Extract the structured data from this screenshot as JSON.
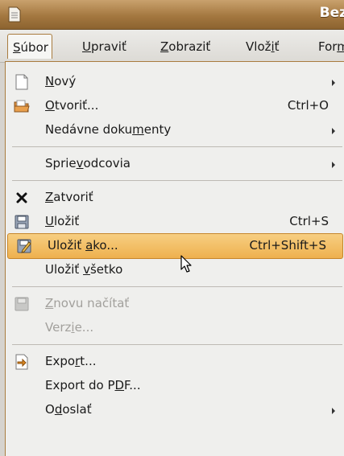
{
  "window": {
    "title": "Bez"
  },
  "menubar": {
    "items": [
      {
        "label": "Súbor",
        "mnemonic": 0,
        "active": true
      },
      {
        "label": "Upraviť",
        "mnemonic": 0
      },
      {
        "label": "Zobraziť",
        "mnemonic": 0
      },
      {
        "label": "Vložiť",
        "mnemonic": 4
      },
      {
        "label": "Form",
        "mnemonic": 3
      }
    ]
  },
  "file_menu": {
    "items": [
      {
        "type": "item",
        "label": "Nový",
        "mnemonic": 0,
        "shortcut": "",
        "submenu": true,
        "icon": "new-document-icon",
        "disabled": false
      },
      {
        "type": "item",
        "label": "Otvoriť...",
        "mnemonic": 0,
        "shortcut": "Ctrl+O",
        "submenu": false,
        "icon": "open-folder-icon",
        "disabled": false
      },
      {
        "type": "item",
        "label": "Nedávne dokumenty",
        "mnemonic": 12,
        "shortcut": "",
        "submenu": true,
        "icon": "",
        "disabled": false
      },
      {
        "type": "separator"
      },
      {
        "type": "item",
        "label": "Sprievodcovia",
        "mnemonic": 5,
        "shortcut": "",
        "submenu": true,
        "icon": "",
        "disabled": false
      },
      {
        "type": "separator"
      },
      {
        "type": "item",
        "label": "Zatvoriť",
        "mnemonic": 0,
        "shortcut": "",
        "submenu": false,
        "icon": "close-x-icon",
        "disabled": false
      },
      {
        "type": "item",
        "label": "Uložiť",
        "mnemonic": 0,
        "shortcut": "Ctrl+S",
        "submenu": false,
        "icon": "save-floppy-icon",
        "disabled": false
      },
      {
        "type": "item",
        "label": "Uložiť ako...",
        "mnemonic": 7,
        "shortcut": "Ctrl+Shift+S",
        "submenu": false,
        "icon": "save-as-icon",
        "disabled": false,
        "highlighted": true
      },
      {
        "type": "item",
        "label": "Uložiť všetko",
        "mnemonic": 7,
        "shortcut": "",
        "submenu": false,
        "icon": "",
        "disabled": false
      },
      {
        "type": "separator"
      },
      {
        "type": "item",
        "label": "Znovu načítať",
        "mnemonic": 0,
        "shortcut": "",
        "submenu": false,
        "icon": "reload-icon",
        "disabled": true
      },
      {
        "type": "item",
        "label": "Verzie...",
        "mnemonic": 4,
        "shortcut": "",
        "submenu": false,
        "icon": "",
        "disabled": true
      },
      {
        "type": "separator"
      },
      {
        "type": "item",
        "label": "Export...",
        "mnemonic": 4,
        "shortcut": "",
        "submenu": false,
        "icon": "export-icon",
        "disabled": false
      },
      {
        "type": "item",
        "label": "Export do PDF...",
        "mnemonic": 11,
        "shortcut": "",
        "submenu": false,
        "icon": "",
        "disabled": false
      },
      {
        "type": "item",
        "label": "Odoslať",
        "mnemonic": 1,
        "shortcut": "",
        "submenu": true,
        "icon": "",
        "disabled": false
      }
    ]
  },
  "colors": {
    "accent": "#eeb04e",
    "titlebar": "#a47840",
    "menu_bg": "#efefed",
    "disabled_text": "#a2a09c"
  }
}
